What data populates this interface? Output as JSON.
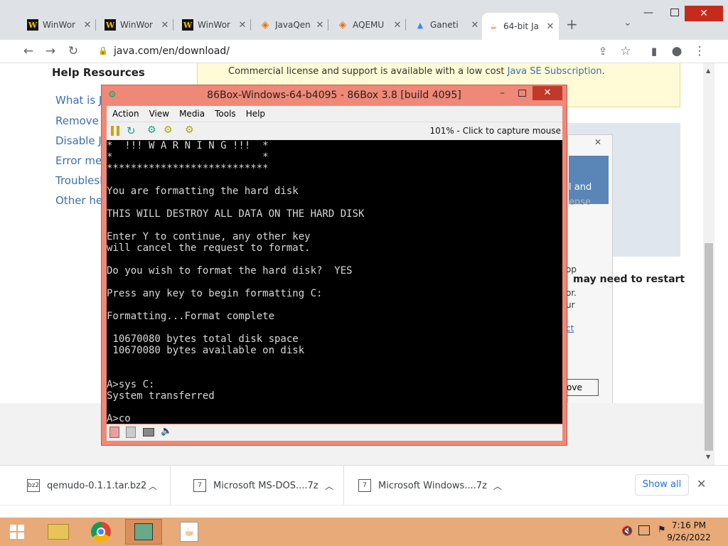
{
  "tabs": [
    {
      "label": "WinWor",
      "icon": "winworld-icon"
    },
    {
      "label": "WinWor",
      "icon": "winworld-icon"
    },
    {
      "label": "WinWor",
      "icon": "winworld-icon"
    },
    {
      "label": "JavaQen",
      "icon": "javaqemu-icon"
    },
    {
      "label": "AQEMU",
      "icon": "aqemu-icon"
    },
    {
      "label": "Ganeti",
      "icon": "google-icon"
    },
    {
      "label": "64-bit Ja",
      "icon": "java-icon"
    }
  ],
  "address": {
    "url": "java.com/en/download/"
  },
  "page": {
    "sidebar_heading": "Help Resources",
    "links": [
      "What is J",
      "Remove c",
      "Disable J",
      "Error mes",
      "Troublesh",
      "Other hel"
    ],
    "banner_text": "Commercial license and support is available with a low cost ",
    "banner_link": "Java SE Subscription",
    "banner_end": ".",
    "right_text": {
      "a": "l and",
      "b": "ense",
      "c": "op",
      "d": "may need to restart",
      "e": "or.",
      "f": "ur",
      "g": "ct",
      "h": "ove"
    }
  },
  "vm": {
    "title": "86Box-Windows-64-b4095 - 86Box 3.8 [build 4095]",
    "menu": [
      "Action",
      "View",
      "Media",
      "Tools",
      "Help"
    ],
    "status": "101% - Click to capture mouse",
    "screen_lines": [
      "*  !!! W A R N I N G !!!  *",
      "*                         *",
      "***************************",
      "",
      "You are formatting the hard disk",
      "",
      "THIS WILL DESTROY ALL DATA ON THE HARD DISK",
      "",
      "Enter Y to continue, any other key",
      "will cancel the request to format.",
      "",
      "Do you wish to format the hard disk?  YES",
      "",
      "Press any key to begin formatting C:",
      "",
      "Formatting...Format complete",
      "",
      " 10670080 bytes total disk space",
      " 10670080 bytes available on disk",
      "",
      "",
      "A>sys C:",
      "System transferred",
      "",
      "A>co_"
    ]
  },
  "downloads": [
    {
      "name": "qemudo-0.1.1.tar.bz2",
      "icon": "bz2-file-icon"
    },
    {
      "name": "Microsoft MS-DOS....7z",
      "icon": "7z-file-icon"
    },
    {
      "name": "Microsoft Windows....7z",
      "icon": "7z-file-icon"
    }
  ],
  "show_all": "Show all",
  "clock": {
    "time": "7:16 PM",
    "date": "9/26/2022"
  }
}
